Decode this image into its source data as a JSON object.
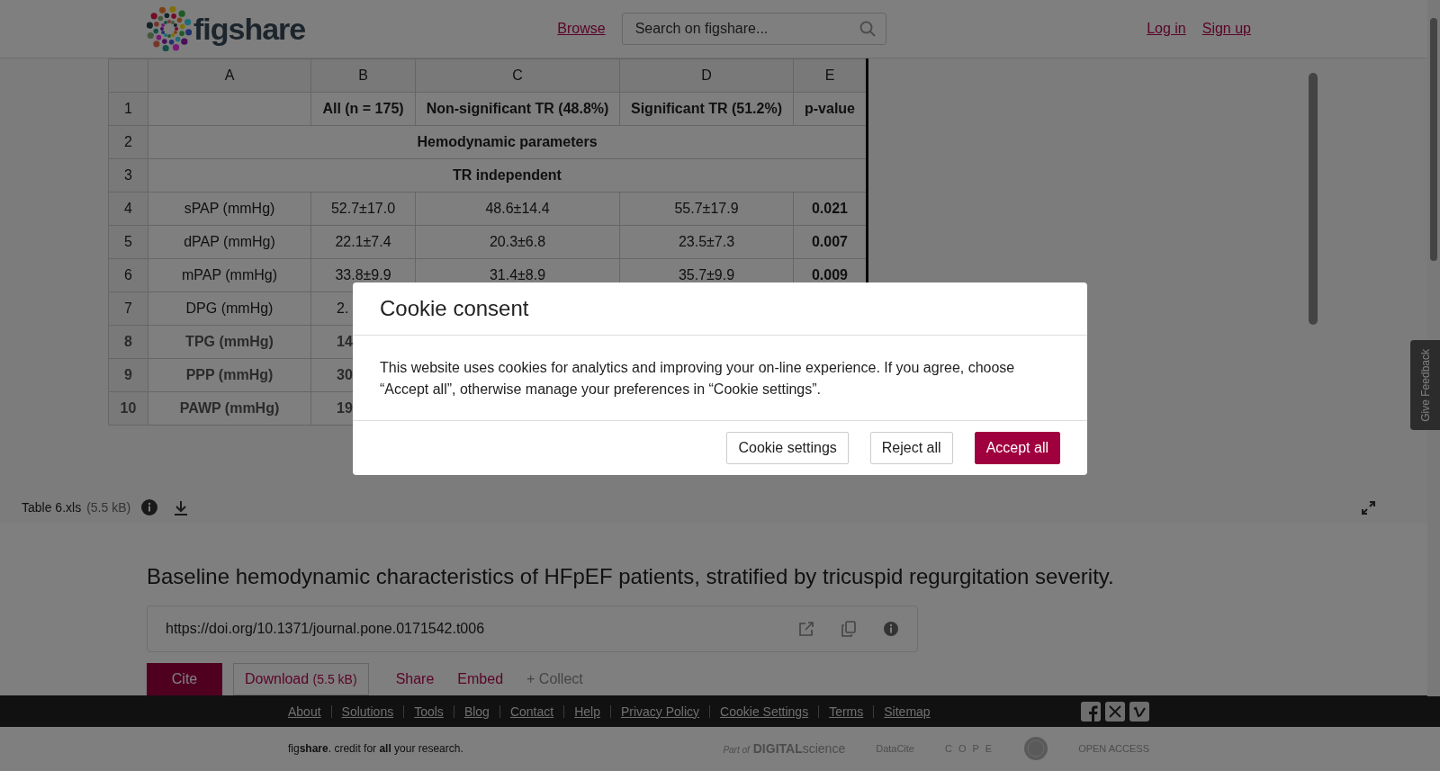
{
  "header": {
    "logo_text": "figshare",
    "nav_link": "Browse",
    "search": {
      "placeholder": "Search on figshare..."
    },
    "auth_links": [
      "Log in",
      "Sign up"
    ]
  },
  "viewer": {
    "columns": [
      "A",
      "B",
      "C",
      "D",
      "E"
    ],
    "rows": [
      {
        "num": "1",
        "kind": "header",
        "cells": [
          "",
          "All (n = 175)",
          "Non-significant TR (48.8%)",
          "Significant TR (51.2%)",
          "p-value"
        ]
      },
      {
        "num": "2",
        "kind": "section",
        "cells": [
          {
            "text": "Hemodynamic parameters",
            "colspan": 5
          }
        ]
      },
      {
        "num": "3",
        "kind": "section",
        "cells": [
          {
            "text": "TR independent",
            "colspan": 5
          }
        ]
      },
      {
        "num": "4",
        "kind": "data",
        "cells": [
          "sPAP (mmHg)",
          "52.7±17.0",
          "48.6±14.4",
          "55.7±17.9",
          "0.021"
        ]
      },
      {
        "num": "5",
        "kind": "data",
        "cells": [
          "dPAP (mmHg)",
          "22.1±7.4",
          "20.3±6.8",
          "23.5±7.3",
          "0.007"
        ]
      },
      {
        "num": "6",
        "kind": "data",
        "cells": [
          "mPAP (mmHg)",
          "33.8±9.9",
          "31.4±8.9",
          "35.7±9.9",
          "0.009"
        ]
      },
      {
        "num": "7",
        "kind": "cut",
        "cells": [
          "DPG (mmHg)",
          "2."
        ]
      },
      {
        "num": "8",
        "kind": "faded",
        "cells": [
          "TPG (mmHg)",
          "14"
        ]
      },
      {
        "num": "9",
        "kind": "faded",
        "cells": [
          "PPP (mmHg)",
          "30"
        ]
      },
      {
        "num": "10",
        "kind": "faded",
        "cells": [
          "PAWP (mmHg)",
          "19"
        ]
      }
    ]
  },
  "file_bar": {
    "name": "Table 6.xls",
    "size": "(5.5 kB)"
  },
  "item": {
    "title": "Baseline hemodynamic characteristics of HFpEF patients, stratified by tricuspid regurgitation severity.",
    "doi": "https://doi.org/10.1371/journal.pone.0171542.t006",
    "actions": [
      {
        "kind": "primary",
        "label": "Cite"
      },
      {
        "kind": "outline",
        "label": "Download",
        "size": "(5.5 kB)"
      },
      {
        "kind": "link",
        "label": "Share"
      },
      {
        "kind": "link",
        "label": "Embed"
      },
      {
        "kind": "muted",
        "label": "+ Collect"
      }
    ]
  },
  "footer": {
    "links": [
      "About",
      "Solutions",
      "Tools",
      "Blog",
      "Contact",
      "Help",
      "Privacy Policy",
      "Cookie Settings",
      "Terms",
      "Sitemap"
    ],
    "tagline": "fig**share**. credit for **all** your research.",
    "partners": [
      {
        "kind": "ds",
        "prefix": "Part of",
        "name": "DIGITAL",
        "suffix": "science"
      },
      {
        "kind": "datacite",
        "name": "DataCite"
      },
      {
        "kind": "cope",
        "name": "C O P E"
      },
      {
        "kind": "seal"
      },
      {
        "kind": "oa",
        "name": "OPEN ACCESS"
      }
    ]
  },
  "feedback_tab": "Give Feedback",
  "cookie_dialog": {
    "title": "Cookie consent",
    "text": "This website uses cookies for analytics and improving your on-line experience. If you agree, choose “Accept all”, otherwise manage your preferences in “Cookie settings”.",
    "buttons": [
      {
        "kind": "secondary",
        "label": "Cookie settings"
      },
      {
        "kind": "secondary",
        "label": "Reject all"
      },
      {
        "kind": "primary",
        "label": "Accept all"
      }
    ]
  }
}
